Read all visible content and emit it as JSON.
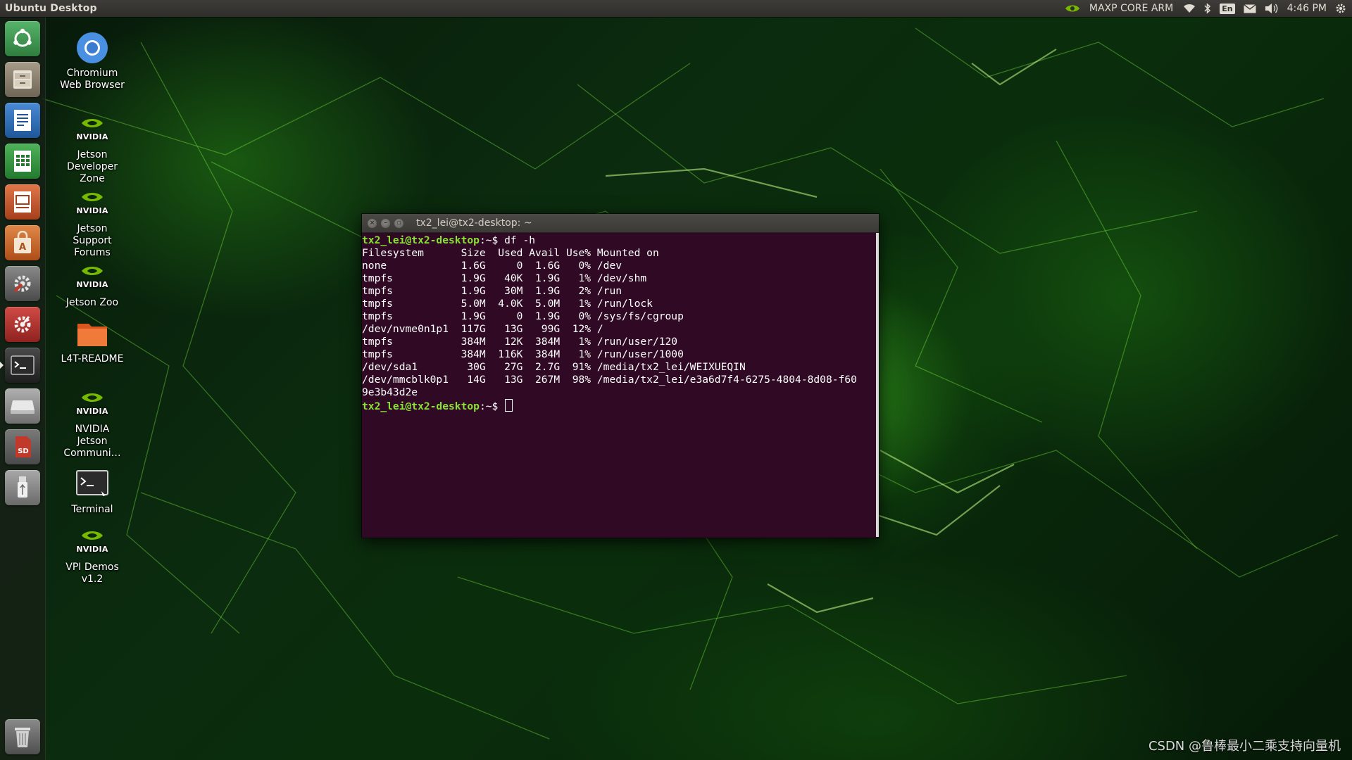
{
  "top_panel": {
    "app_title": "Ubuntu Desktop",
    "nvidia_mode": "MAXP CORE ARM",
    "keyboard_layout": "En",
    "time": "4:46 PM",
    "tray_icons": [
      "nvidia-power-icon",
      "wifi-icon",
      "bluetooth-icon",
      "keyboard-layout",
      "mail-icon",
      "volume-icon",
      "time",
      "settings-gear-icon"
    ]
  },
  "launcher": {
    "items": [
      {
        "name": "dash-home",
        "icon": "ubuntu-logo-icon",
        "color": "#3e9a52"
      },
      {
        "name": "files",
        "icon": "file-cabinet-icon",
        "color": "#8a7f6e"
      },
      {
        "name": "libreoffice-writer",
        "icon": "writer-document-icon",
        "color": "#2d6bb0"
      },
      {
        "name": "libreoffice-calc",
        "icon": "calc-spreadsheet-icon",
        "color": "#2f8a3a"
      },
      {
        "name": "libreoffice-impress",
        "icon": "impress-presentation-icon",
        "color": "#c4532a"
      },
      {
        "name": "software-center",
        "icon": "shopping-bag-icon",
        "color": "#c9622a"
      },
      {
        "name": "system-settings",
        "icon": "wrench-gear-icon",
        "color": "#6a6a6a"
      },
      {
        "name": "software-updater",
        "icon": "updater-gear-icon",
        "color": "#b5312f"
      },
      {
        "name": "terminal",
        "icon": "terminal-icon",
        "color": "#2c2c2c",
        "active": true
      },
      {
        "name": "disks",
        "icon": "drive-icon",
        "color": "#9a9a9a"
      },
      {
        "name": "sd-card",
        "icon": "sd-card-icon",
        "color": "#c0392b"
      },
      {
        "name": "usb-drive",
        "icon": "usb-icon",
        "color": "#8a8a8a"
      },
      {
        "name": "trash",
        "icon": "trash-icon",
        "color": "#7a7a7a"
      }
    ]
  },
  "desktop_icons": [
    {
      "label": "Chromium Web Browser",
      "icon": "chromium-icon"
    },
    {
      "label": "Jetson Developer Zone",
      "icon": "nvidia-logo-icon"
    },
    {
      "label": "Jetson Support Forums",
      "icon": "nvidia-logo-icon"
    },
    {
      "label": "Jetson Zoo",
      "icon": "nvidia-logo-icon"
    },
    {
      "label": "L4T-README",
      "icon": "folder-icon"
    },
    {
      "label": "NVIDIA Jetson Communi…",
      "icon": "nvidia-logo-icon"
    },
    {
      "label": "Terminal",
      "icon": "terminal-icon"
    },
    {
      "label": "VPI Demos v1.2",
      "icon": "nvidia-logo-icon"
    }
  ],
  "nvidia_word": "NVIDIA",
  "terminal": {
    "title": "tx2_lei@tx2-desktop: ~",
    "prompt": "tx2_lei@tx2-desktop",
    "prompt_suffix": ":~$ ",
    "command": "df -h",
    "output_lines": [
      "Filesystem      Size  Used Avail Use% Mounted on",
      "none            1.6G     0  1.6G   0% /dev",
      "tmpfs           1.9G   40K  1.9G   1% /dev/shm",
      "tmpfs           1.9G   30M  1.9G   2% /run",
      "tmpfs           5.0M  4.0K  5.0M   1% /run/lock",
      "tmpfs           1.9G     0  1.9G   0% /sys/fs/cgroup",
      "/dev/nvme0n1p1  117G   13G   99G  12% /",
      "tmpfs           384M   12K  384M   1% /run/user/120",
      "tmpfs           384M  116K  384M   1% /run/user/1000",
      "/dev/sda1        30G   27G  2.7G  91% /media/tx2_lei/WEIXUEQIN",
      "/dev/mmcblk0p1   14G   13G  267M  98% /media/tx2_lei/e3a6d7f4-6275-4804-8d08-f60",
      "9e3b43d2e"
    ]
  },
  "watermark": "CSDN @鲁棒最小二乘支持向量机",
  "colors": {
    "terminal_bg": "#300a24",
    "prompt_green": "#8ae234",
    "panel_bg": "#3d3c38",
    "nvidia_green": "#76b900"
  }
}
